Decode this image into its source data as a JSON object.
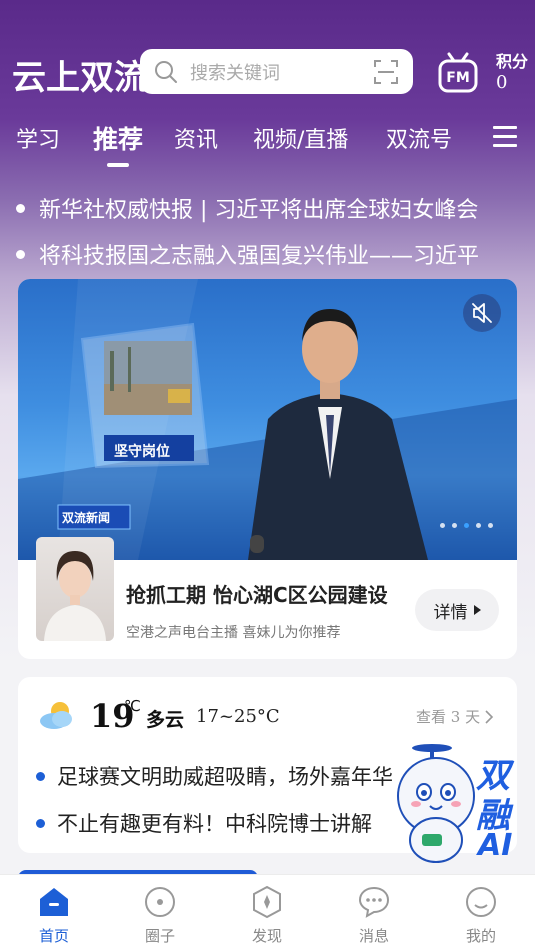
{
  "header": {
    "app_title": "云上双流",
    "search_placeholder": "搜索关键词",
    "points_label": "积分",
    "points_value": "0"
  },
  "tabs": [
    {
      "label": "学习",
      "active": false
    },
    {
      "label": "推荐",
      "active": true
    },
    {
      "label": "资讯",
      "active": false
    },
    {
      "label": "视频/直播",
      "active": false
    },
    {
      "label": "双流号",
      "active": false
    }
  ],
  "headlines": [
    "新华社权威快报 | 习近平将出席全球妇女峰会",
    "将科技报国之志融入强国复兴伟业——习近平"
  ],
  "video_card": {
    "overlay_caption": "坚守岗位",
    "overlay_badge": "双流新闻",
    "title": "抢抓工期  怡心湖C区公园建设",
    "subtitle": "空港之声电台主播   喜妹儿为你推荐",
    "detail_label": "详情",
    "carousel_count": 5,
    "carousel_active": 3
  },
  "weather": {
    "temp": "19",
    "unit": "℃",
    "condition": "多云",
    "range": "17~25°C",
    "more_label": "查看 3 天"
  },
  "weather_news": [
    "足球赛文明助威超吸睛，场外嘉年华",
    "不止有趣更有料！中科院博士讲解"
  ],
  "ai_float": {
    "label_line1": "双",
    "label_line2": "融",
    "label_line3": "AI"
  },
  "bottom_nav": [
    {
      "label": "首页",
      "icon": "home-icon",
      "active": true
    },
    {
      "label": "圈子",
      "icon": "circle-icon",
      "active": false
    },
    {
      "label": "发现",
      "icon": "compass-icon",
      "active": false
    },
    {
      "label": "消息",
      "icon": "message-icon",
      "active": false
    },
    {
      "label": "我的",
      "icon": "profile-icon",
      "active": false
    }
  ],
  "colors": {
    "brand_blue": "#1d5fd6",
    "header_purple": "#5a2a8a"
  }
}
